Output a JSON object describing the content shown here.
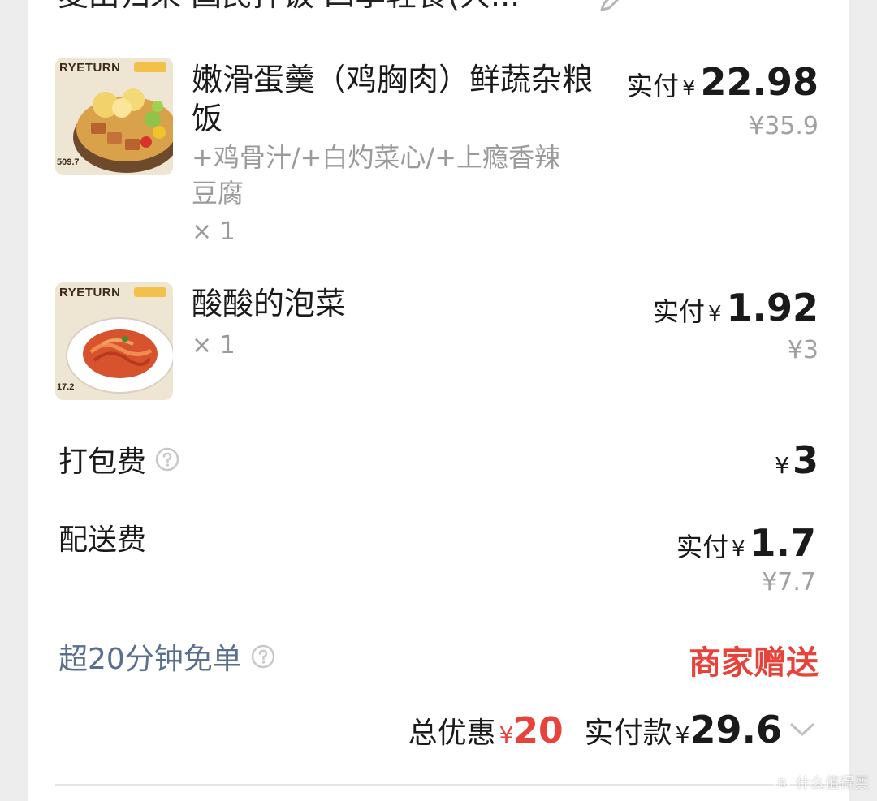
{
  "store": {
    "title": "麦田归来·国民拌饭·四季轻食(大..."
  },
  "items": [
    {
      "thumb_brand": "RYETURN",
      "thumb_kcal": "509.7",
      "name": "嫩滑蛋羹（鸡胸肉）鲜蔬杂粮饭",
      "spec": "+鸡骨汁/+白灼菜心/+上瘾香辣豆腐",
      "qty": "× 1",
      "pay_label": "实付",
      "pay_symbol": "¥",
      "pay_amount": "22.98",
      "original_price": "¥35.9"
    },
    {
      "thumb_brand": "RYETURN",
      "thumb_kcal": "17.2",
      "name": "酸酸的泡菜",
      "qty": "× 1",
      "pay_label": "实付",
      "pay_symbol": "¥",
      "pay_amount": "1.92",
      "original_price": "¥3"
    }
  ],
  "packing_fee": {
    "label": "打包费",
    "symbol": "¥",
    "amount": "3"
  },
  "delivery_fee": {
    "label": "配送费",
    "pay_label": "实付",
    "symbol": "¥",
    "amount": "1.7",
    "original_price": "¥7.7"
  },
  "free_order": {
    "label": "超20分钟免单",
    "value": "商家赠送"
  },
  "summary": {
    "discount_label": "总优惠",
    "discount_symbol": "¥",
    "discount_amount": "20",
    "paid_label": "实付款",
    "paid_symbol": "¥",
    "paid_amount": "29.6"
  },
  "watermark": {
    "text": "什么值得买"
  },
  "colors": {
    "accent_red": "#e8433a",
    "link_blue": "#5a6e8e",
    "muted": "#9a9a9a"
  },
  "icons": [
    "edit-pencil-icon",
    "help-circle-icon",
    "chevron-down-icon",
    "watermark-logo-icon"
  ]
}
